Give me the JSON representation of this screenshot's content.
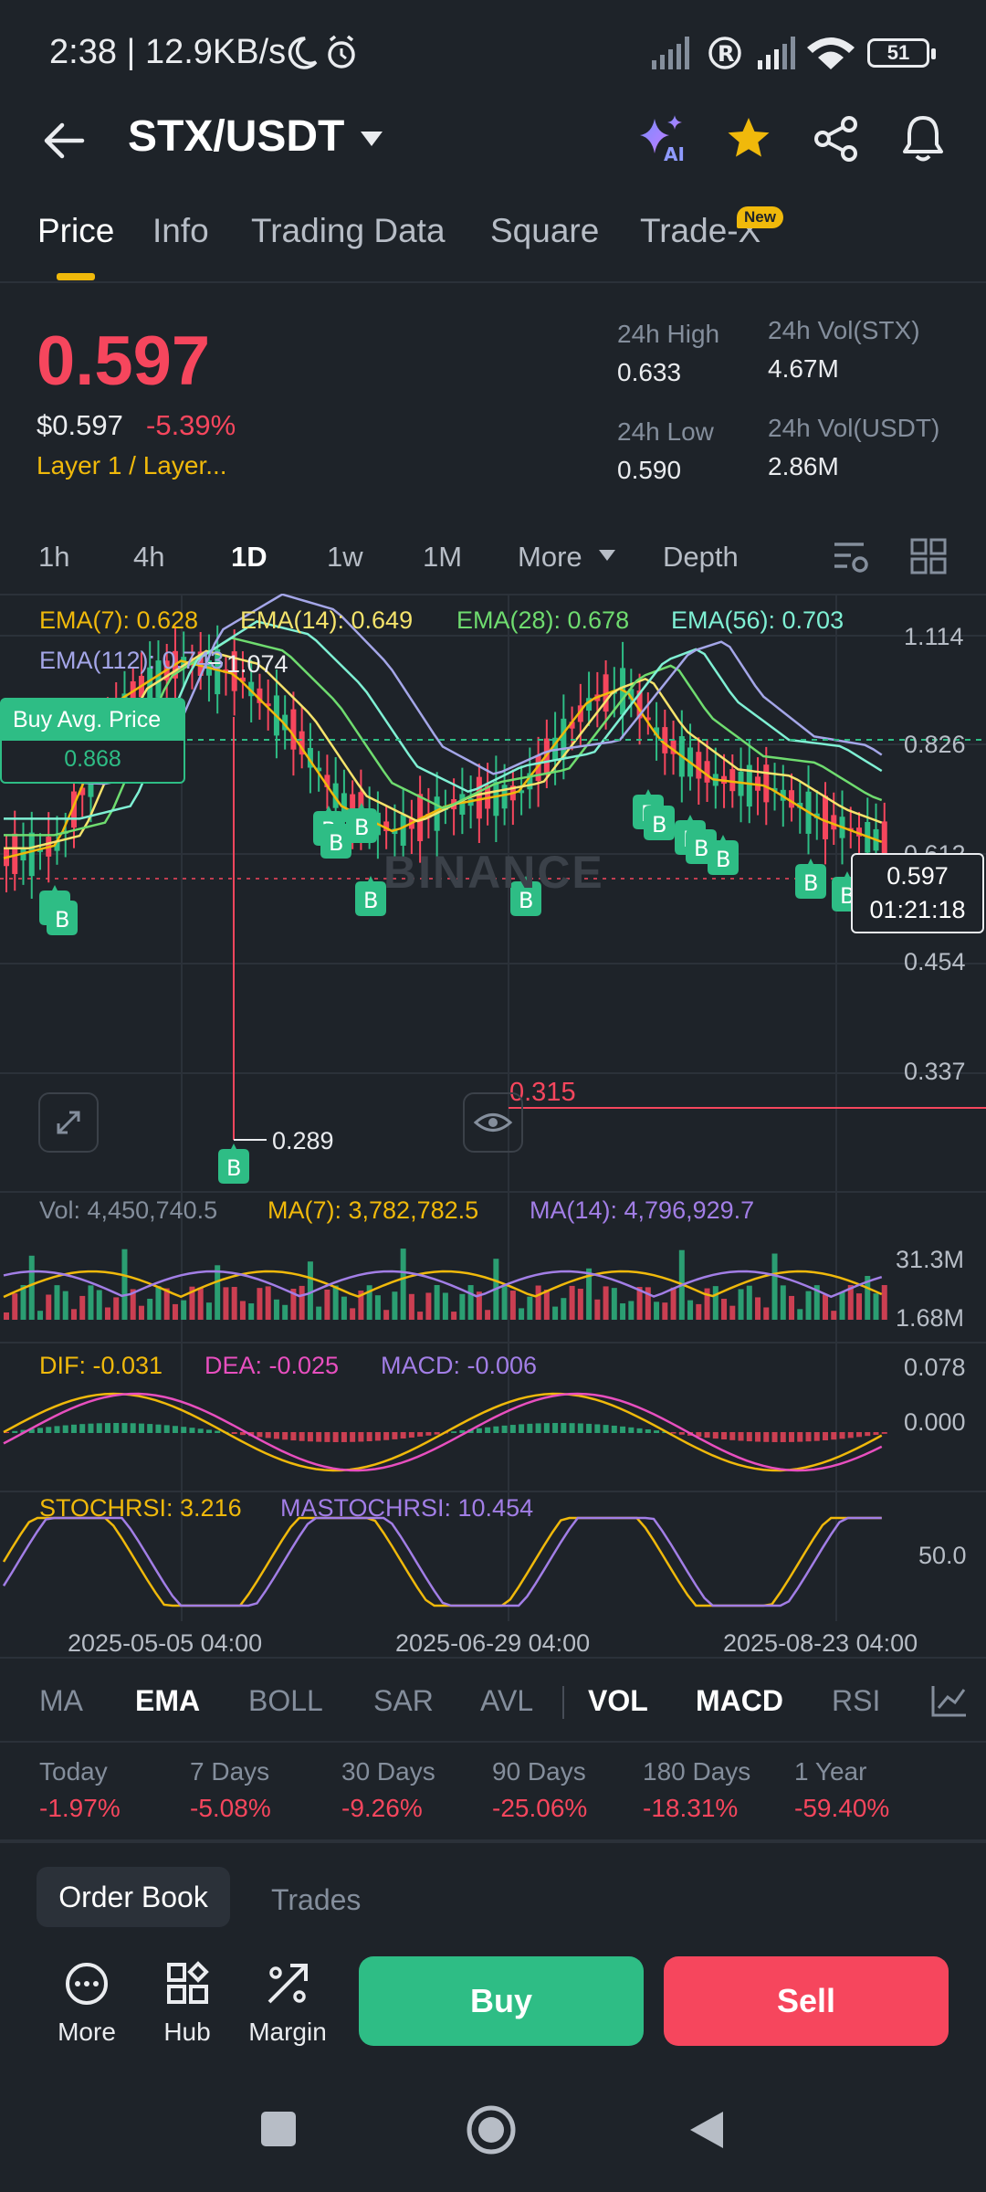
{
  "status_bar": {
    "time_speed": "2:38 | 12.9KB/s",
    "battery": "51"
  },
  "header": {
    "pair": "STX/USDT",
    "ai_label": "AI"
  },
  "tabs": [
    {
      "label": "Price"
    },
    {
      "label": "Info"
    },
    {
      "label": "Trading Data"
    },
    {
      "label": "Square"
    },
    {
      "label": "Trade-X"
    }
  ],
  "new_badge": "New",
  "price": {
    "last": "0.597",
    "usd": "$0.597",
    "change": "-5.39%",
    "sector": "Layer 1 / Layer..."
  },
  "stats": {
    "high_label": "24h High",
    "high_value": "0.633",
    "low_label": "24h Low",
    "low_value": "0.590",
    "vol_stx_label": "24h Vol(STX)",
    "vol_stx_value": "4.67M",
    "vol_usdt_label": "24h Vol(USDT)",
    "vol_usdt_value": "2.86M"
  },
  "intervals": [
    "1h",
    "4h",
    "1D",
    "1w",
    "1M",
    "More",
    "Depth"
  ],
  "ema": {
    "ema7": "EMA(7): 0.628",
    "ema14": "EMA(14): 0.649",
    "ema28": "EMA(28): 0.678",
    "ema56": "EMA(56): 0.703",
    "ema112": "EMA(112): 0.743"
  },
  "chart_labels": {
    "high_marker": "1.074",
    "low_marker": "0.289",
    "buy_avg_title": "Buy Avg. Price",
    "buy_avg_value": "0.868",
    "current_price": "0.597",
    "countdown": "01:21:18",
    "alert_line": "0.315",
    "watermark": "BINANCE",
    "buy_marker": "B",
    "price_axis": [
      "1.114",
      "0.826",
      "0.612",
      "0.454",
      "0.337"
    ],
    "vol_line": "Vol: 4,450,740.5",
    "vol_ma7": "MA(7): 3,782,782.5",
    "vol_ma14": "MA(14): 4,796,929.7",
    "vol_axis": [
      "31.3M",
      "1.68M"
    ],
    "dif": "DIF: -0.031",
    "dea": "DEA: -0.025",
    "macd": "MACD: -0.006",
    "macd_axis": [
      "0.078",
      "0.000"
    ],
    "stoch": "STOCHRSI: 3.216",
    "mastoch": "MASTOCHRSI: 10.454",
    "stoch_axis": "50.0",
    "dates": [
      "2025-05-05 04:00",
      "2025-06-29 04:00",
      "2025-08-23 04:00"
    ]
  },
  "indicators": [
    "MA",
    "EMA",
    "BOLL",
    "SAR",
    "AVL",
    "VOL",
    "MACD",
    "RSI"
  ],
  "performance": [
    {
      "label": "Today",
      "value": "-1.97%"
    },
    {
      "label": "7 Days",
      "value": "-5.08%"
    },
    {
      "label": "30 Days",
      "value": "-9.26%"
    },
    {
      "label": "90 Days",
      "value": "-25.06%"
    },
    {
      "label": "180 Days",
      "value": "-18.31%"
    },
    {
      "label": "1 Year",
      "value": "-59.40%"
    }
  ],
  "book_tabs": {
    "order_book": "Order Book",
    "trades": "Trades"
  },
  "bottom": {
    "more": "More",
    "hub": "Hub",
    "margin": "Margin",
    "buy": "Buy",
    "sell": "Sell"
  },
  "colors": {
    "bg": "#1e2329",
    "up": "#2ebd85",
    "down": "#f6465d",
    "brand": "#f0b90b",
    "ema7": "#f0b90b",
    "ema14": "#f5e36b",
    "ema28": "#6fdc6f",
    "ema56": "#7ff0d4",
    "ema112": "#a4a6e8"
  }
}
